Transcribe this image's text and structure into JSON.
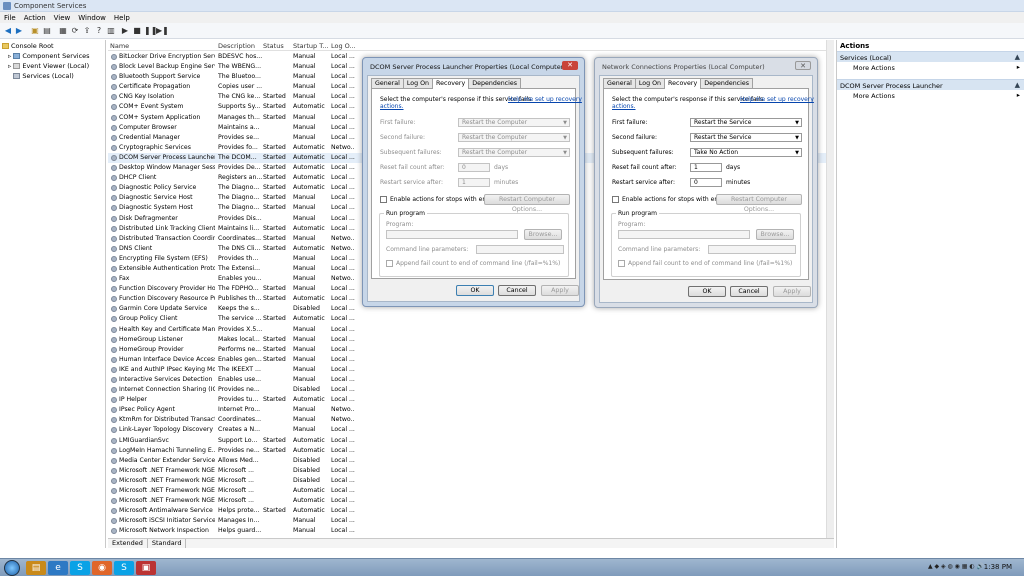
{
  "app": {
    "title": "Component Services"
  },
  "menu": [
    "File",
    "Action",
    "View",
    "Window",
    "Help"
  ],
  "tree": {
    "root": "Console Root",
    "items": [
      "Component Services",
      "Event Viewer (Local)",
      "Services (Local)"
    ]
  },
  "columns": [
    "Name",
    "Description",
    "Status",
    "Startup T...",
    "Log O..."
  ],
  "services": [
    [
      "BitLocker Drive Encryption Service",
      "BDESVC hos...",
      "",
      "Manual",
      "Local ..."
    ],
    [
      "Block Level Backup Engine Servi...",
      "The WBENG...",
      "",
      "Manual",
      "Local ..."
    ],
    [
      "Bluetooth Support Service",
      "The Bluetoo...",
      "",
      "Manual",
      "Local ..."
    ],
    [
      "Certificate Propagation",
      "Copies user ...",
      "",
      "Manual",
      "Local ..."
    ],
    [
      "CNG Key Isolation",
      "The CNG ke...",
      "Started",
      "Manual",
      "Local ..."
    ],
    [
      "COM+ Event System",
      "Supports Sy...",
      "Started",
      "Automatic",
      "Local ..."
    ],
    [
      "COM+ System Application",
      "Manages th...",
      "Started",
      "Manual",
      "Local ..."
    ],
    [
      "Computer Browser",
      "Maintains a...",
      "",
      "Manual",
      "Local ..."
    ],
    [
      "Credential Manager",
      "Provides se...",
      "",
      "Manual",
      "Local ..."
    ],
    [
      "Cryptographic Services",
      "Provides fo...",
      "Started",
      "Automatic",
      "Netwo..."
    ],
    [
      "DCOM Server Process Launcher",
      "The DCOM...",
      "Started",
      "Automatic",
      "Local ..."
    ],
    [
      "Desktop Window Manager Sessi...",
      "Provides De...",
      "Started",
      "Automatic",
      "Local ..."
    ],
    [
      "DHCP Client",
      "Registers an...",
      "Started",
      "Automatic",
      "Local ..."
    ],
    [
      "Diagnostic Policy Service",
      "The Diagno...",
      "Started",
      "Automatic",
      "Local ..."
    ],
    [
      "Diagnostic Service Host",
      "The Diagno...",
      "Started",
      "Manual",
      "Local ..."
    ],
    [
      "Diagnostic System Host",
      "The Diagno...",
      "Started",
      "Manual",
      "Local ..."
    ],
    [
      "Disk Defragmenter",
      "Provides Dis...",
      "",
      "Manual",
      "Local ..."
    ],
    [
      "Distributed Link Tracking Client",
      "Maintains li...",
      "Started",
      "Automatic",
      "Local ..."
    ],
    [
      "Distributed Transaction Coordin...",
      "Coordinates...",
      "Started",
      "Manual",
      "Netwo..."
    ],
    [
      "DNS Client",
      "The DNS Cli...",
      "Started",
      "Automatic",
      "Netwo..."
    ],
    [
      "Encrypting File System (EFS)",
      "Provides th...",
      "",
      "Manual",
      "Local ..."
    ],
    [
      "Extensible Authentication Proto...",
      "The Extensi...",
      "",
      "Manual",
      "Local ..."
    ],
    [
      "Fax",
      "Enables you...",
      "",
      "Manual",
      "Netwo..."
    ],
    [
      "Function Discovery Provider Host",
      "The FDPHO...",
      "Started",
      "Manual",
      "Local ..."
    ],
    [
      "Function Discovery Resource Pu...",
      "Publishes th...",
      "Started",
      "Automatic",
      "Local ..."
    ],
    [
      "Garmin Core Update Service",
      "Keeps the s...",
      "",
      "Disabled",
      "Local ..."
    ],
    [
      "Group Policy Client",
      "The service ...",
      "Started",
      "Automatic",
      "Local ..."
    ],
    [
      "Health Key and Certificate Mana...",
      "Provides X.5...",
      "",
      "Manual",
      "Local ..."
    ],
    [
      "HomeGroup Listener",
      "Makes local...",
      "Started",
      "Manual",
      "Local ..."
    ],
    [
      "HomeGroup Provider",
      "Performs ne...",
      "Started",
      "Manual",
      "Local ..."
    ],
    [
      "Human Interface Device Access",
      "Enables gen...",
      "Started",
      "Manual",
      "Local ..."
    ],
    [
      "IKE and AuthIP IPsec Keying Mo...",
      "The IKEEXT ...",
      "",
      "Manual",
      "Local ..."
    ],
    [
      "Interactive Services Detection",
      "Enables use...",
      "",
      "Manual",
      "Local ..."
    ],
    [
      "Internet Connection Sharing (ICS)",
      "Provides ne...",
      "",
      "Disabled",
      "Local ..."
    ],
    [
      "IP Helper",
      "Provides tu...",
      "Started",
      "Automatic",
      "Local ..."
    ],
    [
      "IPsec Policy Agent",
      "Internet Pro...",
      "",
      "Manual",
      "Netwo..."
    ],
    [
      "KtmRm for Distributed Transacti...",
      "Coordinates...",
      "",
      "Manual",
      "Netwo..."
    ],
    [
      "Link-Layer Topology Discovery ...",
      "Creates a N...",
      "",
      "Manual",
      "Local ..."
    ],
    [
      "LMIGuardianSvc",
      "Support Lo...",
      "Started",
      "Automatic",
      "Local ..."
    ],
    [
      "LogMeIn Hamachi Tunneling E...",
      "Provides ne...",
      "Started",
      "Automatic",
      "Local ..."
    ],
    [
      "Media Center Extender Service",
      "Allows Med...",
      "",
      "Disabled",
      "Local ..."
    ],
    [
      "Microsoft .NET Framework NGE...",
      "Microsoft ...",
      "",
      "Disabled",
      "Local ..."
    ],
    [
      "Microsoft .NET Framework NGE...",
      "Microsoft ...",
      "",
      "Disabled",
      "Local ..."
    ],
    [
      "Microsoft .NET Framework NGE...",
      "Microsoft ...",
      "",
      "Automatic",
      "Local ..."
    ],
    [
      "Microsoft .NET Framework NGE...",
      "Microsoft ...",
      "",
      "Automatic",
      "Local ..."
    ],
    [
      "Microsoft Antimalware Service",
      "Helps prote...",
      "Started",
      "Automatic",
      "Local ..."
    ],
    [
      "Microsoft iSCSI Initiator Service",
      "Manages In...",
      "",
      "Manual",
      "Local ..."
    ],
    [
      "Microsoft Network Inspection",
      "Helps guard...",
      "",
      "Manual",
      "Local ..."
    ]
  ],
  "selected_row": 10,
  "view_tabs": [
    "Extended",
    "Standard"
  ],
  "actions": {
    "header": "Actions",
    "sections": [
      {
        "title": "Services (Local)",
        "items": [
          "More Actions"
        ]
      },
      {
        "title": "DCOM Server Process Launcher",
        "items": [
          "More Actions"
        ]
      }
    ]
  },
  "dialog1": {
    "title": "DCOM Server Process Launcher Properties (Local Computer)",
    "tabs": [
      "General",
      "Log On",
      "Recovery",
      "Dependencies"
    ],
    "intro": "Select the computer's response if this service fails.",
    "link1": "Help me set up recovery",
    "link2": "actions.",
    "first_failure_label": "First failure:",
    "first_failure": "Restart the Computer",
    "second_failure_label": "Second failure:",
    "second_failure": "Restart the Computer",
    "subsequent_label": "Subsequent failures:",
    "subsequent": "Restart the Computer",
    "reset_label": "Reset fail count after:",
    "reset_value": "0",
    "reset_unit": "days",
    "restart_label": "Restart service after:",
    "restart_value": "1",
    "restart_unit": "minutes",
    "enable_actions": "Enable actions for stops with errors.",
    "restart_options": "Restart Computer Options...",
    "run_program": "Run program",
    "program_label": "Program:",
    "browse": "Browse...",
    "cmd_label": "Command line parameters:",
    "append": "Append fail count to end of command line (/fail=%1%)",
    "ok": "OK",
    "cancel": "Cancel",
    "apply": "Apply"
  },
  "dialog2": {
    "title": "Network Connections Properties (Local Computer)",
    "tabs": [
      "General",
      "Log On",
      "Recovery",
      "Dependencies"
    ],
    "intro": "Select the computer's response if this service fails.",
    "link1": "Help me set up recovery",
    "link2": "actions.",
    "first_failure_label": "First failure:",
    "first_failure": "Restart the Service",
    "second_failure_label": "Second failure:",
    "second_failure": "Restart the Service",
    "subsequent_label": "Subsequent failures:",
    "subsequent": "Take No Action",
    "reset_label": "Reset fail count after:",
    "reset_value": "1",
    "reset_unit": "days",
    "restart_label": "Restart service after:",
    "restart_value": "0",
    "restart_unit": "minutes",
    "enable_actions": "Enable actions for stops with errors.",
    "restart_options": "Restart Computer Options...",
    "run_program": "Run program",
    "program_label": "Program:",
    "browse": "Browse...",
    "cmd_label": "Command line parameters:",
    "append": "Append fail count to end of command line (/fail=%1%)",
    "ok": "OK",
    "cancel": "Cancel",
    "apply": "Apply"
  },
  "taskbar": {
    "clock": "1:38 PM"
  },
  "colors": {
    "selection": "#e4eef9",
    "accent": "#1d5fa8",
    "close": "#c9443a"
  }
}
